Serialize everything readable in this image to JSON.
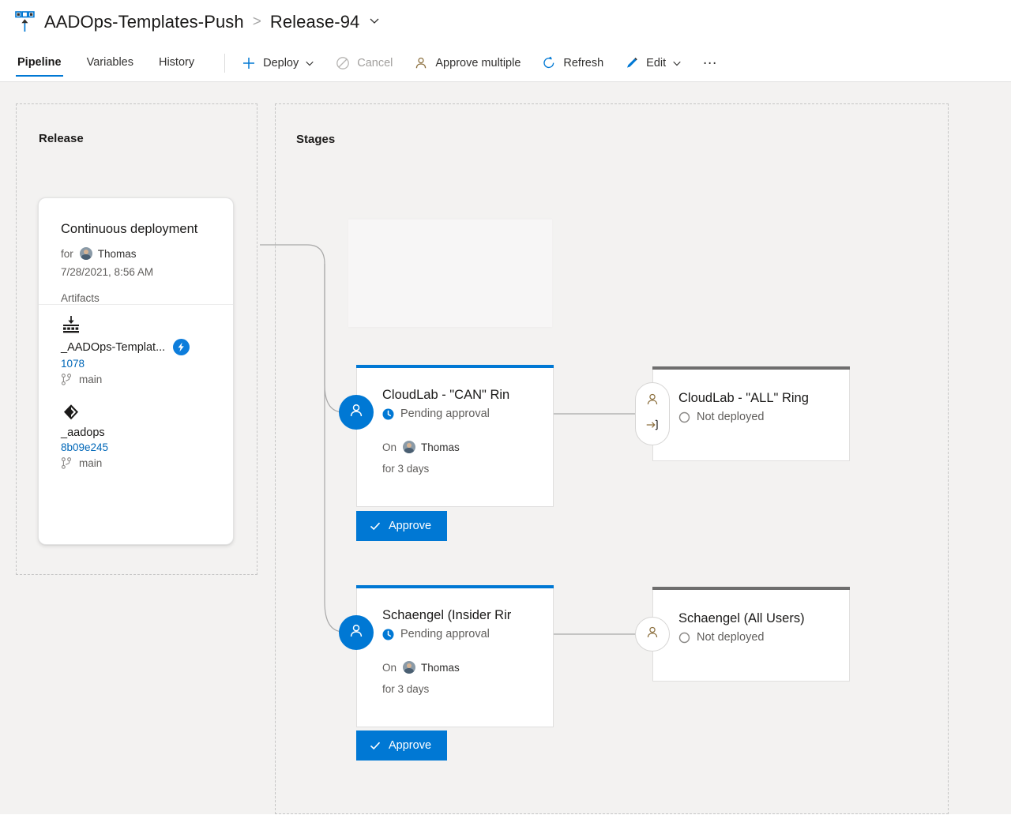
{
  "header": {
    "icon": "release-pipeline-icon",
    "breadcrumb": {
      "project": "AADOps-Templates-Push",
      "separator": ">",
      "release": "Release-94",
      "chevron": "chevron-down-icon"
    },
    "tabs": [
      {
        "label": "Pipeline",
        "active": true
      },
      {
        "label": "Variables",
        "active": false
      },
      {
        "label": "History",
        "active": false
      }
    ],
    "commands": [
      {
        "label": "Deploy",
        "icon": "plus-icon",
        "has_chevron": true,
        "disabled": false
      },
      {
        "label": "Cancel",
        "icon": "cancel-icon",
        "has_chevron": false,
        "disabled": true
      },
      {
        "label": "Approve multiple",
        "icon": "person-icon",
        "has_chevron": false,
        "disabled": false
      },
      {
        "label": "Refresh",
        "icon": "refresh-icon",
        "has_chevron": false,
        "disabled": false
      },
      {
        "label": "Edit",
        "icon": "pencil-icon",
        "has_chevron": true,
        "disabled": false
      },
      {
        "label": "…",
        "icon": "more-icon",
        "has_chevron": false,
        "disabled": false
      }
    ]
  },
  "release_panel": {
    "title": "Release",
    "card": {
      "name": "Continuous deployment",
      "for_label": "for",
      "requested_by": "Thomas",
      "avatar": "user-avatar",
      "date": "7/28/2021, 8:56 AM",
      "artifacts_label": "Artifacts",
      "artifacts": [
        {
          "icon": "build-artifact-icon",
          "name": "_AADOps-Templat...",
          "trigger_badge": "continuous-deployment-trigger-icon",
          "version": "1078",
          "branch_icon": "branch-icon",
          "branch": "main"
        },
        {
          "icon": "git-repo-artifact-icon",
          "name": "_aadops",
          "trigger_badge": null,
          "version": "8b09e245",
          "branch_icon": "branch-icon",
          "branch": "main"
        }
      ]
    }
  },
  "stages_panel": {
    "title": "Stages",
    "stages": [
      {
        "id": "cloudlab-can-ring",
        "name": "CloudLab - \"CAN\" Rin",
        "status": "Pending approval",
        "status_icon": "pending-clock-icon",
        "top_bar_color": "#0078d4",
        "badge": {
          "icons": [
            "person-icon"
          ],
          "style": "filled"
        },
        "meta": {
          "on_label": "On",
          "approver": "Thomas",
          "approver_avatar": "user-avatar",
          "duration": "for 3 days"
        },
        "action": {
          "label": "Approve",
          "icon": "checkmark-icon",
          "color": "#0078d4"
        }
      },
      {
        "id": "cloudlab-all-ring",
        "name": "CloudLab - \"ALL\" Ring",
        "status": "Not deployed",
        "status_icon": "not-deployed-circle-icon",
        "top_bar_color": "#6e6e6e",
        "badge": {
          "icons": [
            "person-icon",
            "gate-icon"
          ],
          "style": "outline"
        },
        "meta": null,
        "action": null
      },
      {
        "id": "schaengel-insider-ring",
        "name": "Schaengel (Insider Rir",
        "status": "Pending approval",
        "status_icon": "pending-clock-icon",
        "top_bar_color": "#0078d4",
        "badge": {
          "icons": [
            "person-icon"
          ],
          "style": "filled"
        },
        "meta": {
          "on_label": "On",
          "approver": "Thomas",
          "approver_avatar": "user-avatar",
          "duration": "for 3 days"
        },
        "action": {
          "label": "Approve",
          "icon": "checkmark-icon",
          "color": "#0078d4"
        }
      },
      {
        "id": "schaengel-all-users",
        "name": "Schaengel (All Users)",
        "status": "Not deployed",
        "status_icon": "not-deployed-circle-icon",
        "top_bar_color": "#6e6e6e",
        "badge": {
          "icons": [
            "person-icon"
          ],
          "style": "outline"
        },
        "meta": null,
        "action": null
      }
    ]
  },
  "colors": {
    "accent": "#0078d4",
    "link": "#0067b8",
    "canvas": "#f3f2f1",
    "muted_text": "#605e5c",
    "gray_bar": "#6e6e6e"
  }
}
